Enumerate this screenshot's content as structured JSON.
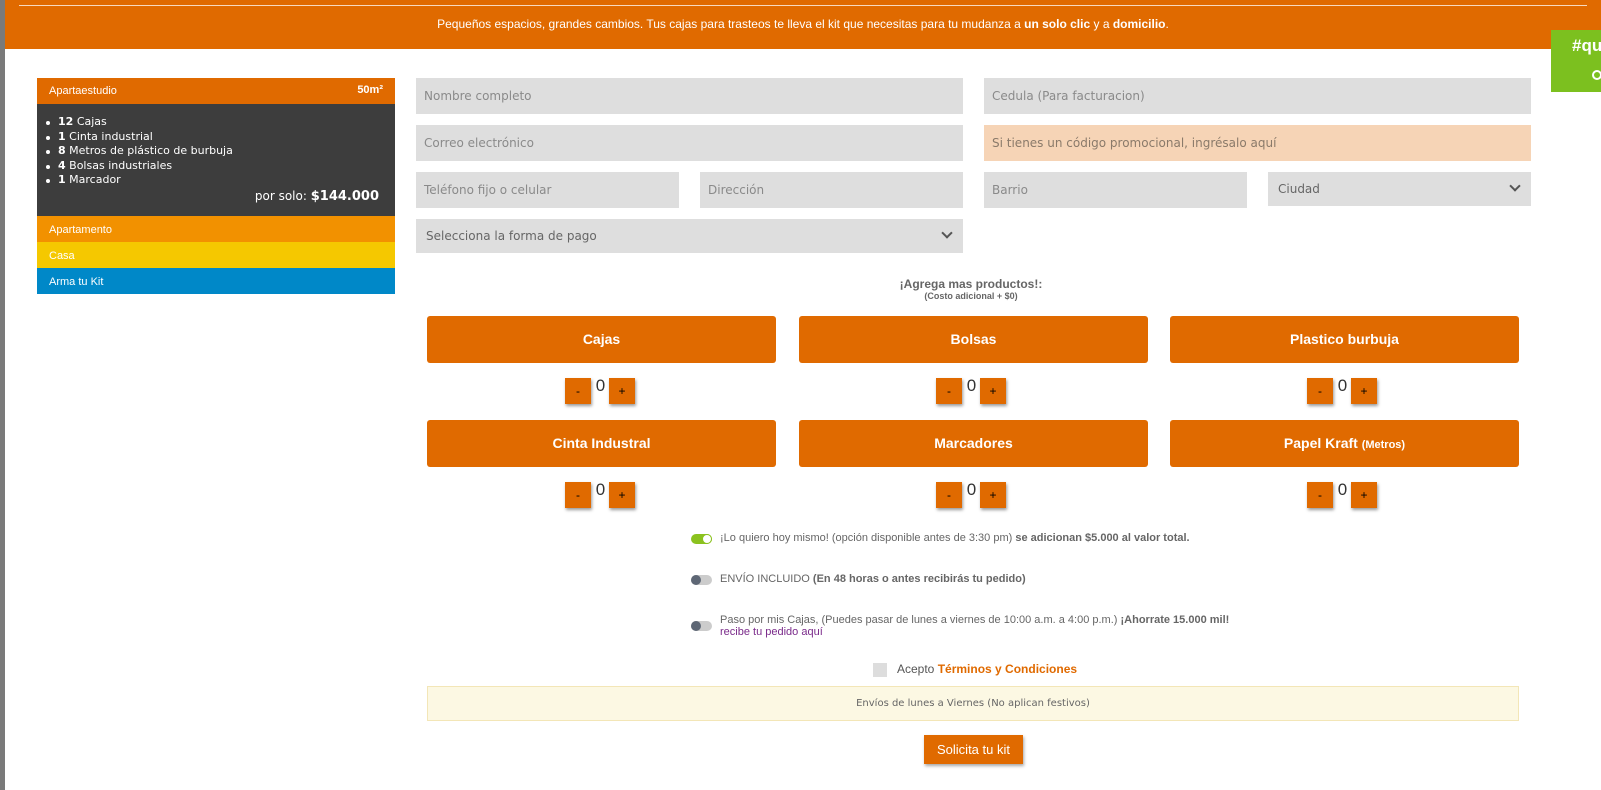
{
  "banner": {
    "text_before": "Pequeños espacios, grandes cambios. Tus cajas para trasteos te lleva el kit que necesitas para tu mudanza a ",
    "bold1": "un solo clic",
    "text_middle": " y a ",
    "bold2": "domicilio",
    "text_after": "."
  },
  "hashtag": {
    "text": "#qu"
  },
  "plan": {
    "name": "Apartaestudio",
    "size": "50m²",
    "items": [
      {
        "qty": "12",
        "label": "Cajas"
      },
      {
        "qty": "1",
        "label": "Cinta industrial"
      },
      {
        "qty": "8",
        "label": "Metros de plástico de burbuja"
      },
      {
        "qty": "4",
        "label": "Bolsas industriales"
      },
      {
        "qty": "1",
        "label": "Marcador"
      }
    ],
    "price_label": "por solo:",
    "price_value": "$144.000",
    "options": [
      {
        "label": "Apartamento",
        "color": "#f29100"
      },
      {
        "label": "Casa",
        "color": "#f5c800"
      },
      {
        "label": "Arma tu Kit",
        "color": "#0088c8"
      }
    ]
  },
  "form": {
    "name_placeholder": "Nombre completo",
    "id_placeholder": "Cedula (Para facturacion)",
    "email_placeholder": "Correo electrónico",
    "promo_placeholder": "Si tienes un código promocional, ingrésalo aquí",
    "phone_placeholder": "Teléfono fijo o celular",
    "address_placeholder": "Dirección",
    "neighborhood_placeholder": "Barrio",
    "city_select": "Ciudad",
    "payment_select": "Selecciona la forma de pago"
  },
  "add_more": {
    "title": "¡Agrega mas productos!:",
    "subtitle": "(Costo adicional + $0)"
  },
  "products": [
    {
      "label": "Cajas",
      "suffix": "",
      "qty": "0"
    },
    {
      "label": "Bolsas",
      "suffix": "",
      "qty": "0"
    },
    {
      "label": "Plastico burbuja",
      "suffix": "",
      "qty": "0"
    },
    {
      "label": "Cinta Industral",
      "suffix": "",
      "qty": "0"
    },
    {
      "label": "Marcadores",
      "suffix": "",
      "qty": "0"
    },
    {
      "label": "Papel Kraft",
      "suffix": "(Metros)",
      "qty": "0"
    }
  ],
  "qty_buttons": {
    "minus": "-",
    "plus": "+"
  },
  "delivery": {
    "option1_text": "¡Lo quiero hoy mismo! (opción disponible antes de 3:30 pm)",
    "option1_bold": "se adicionan $5.000 al valor total.",
    "option2_text": "ENVÍO INCLUIDO",
    "option2_bold": "(En 48 horas o antes recibirás tu pedido)",
    "option3_text": "Paso por mis Cajas, (Puedes pasar de lunes a viernes de 10:00 a.m. a 4:00 p.m.)",
    "option3_bold": "¡Ahorrate 15.000 mil!",
    "option3_link": "recibe tu pedido aquí"
  },
  "terms": {
    "text": "Acepto",
    "link": "Términos y Condiciones"
  },
  "notice": "Envíos de lunes a Viernes (No aplican festivos)",
  "submit": "Solicita tu kit",
  "colors": {
    "brand_orange": "#e06a00",
    "toggle_green": "#8bc21f",
    "hashtag_green": "#7cc01f"
  }
}
